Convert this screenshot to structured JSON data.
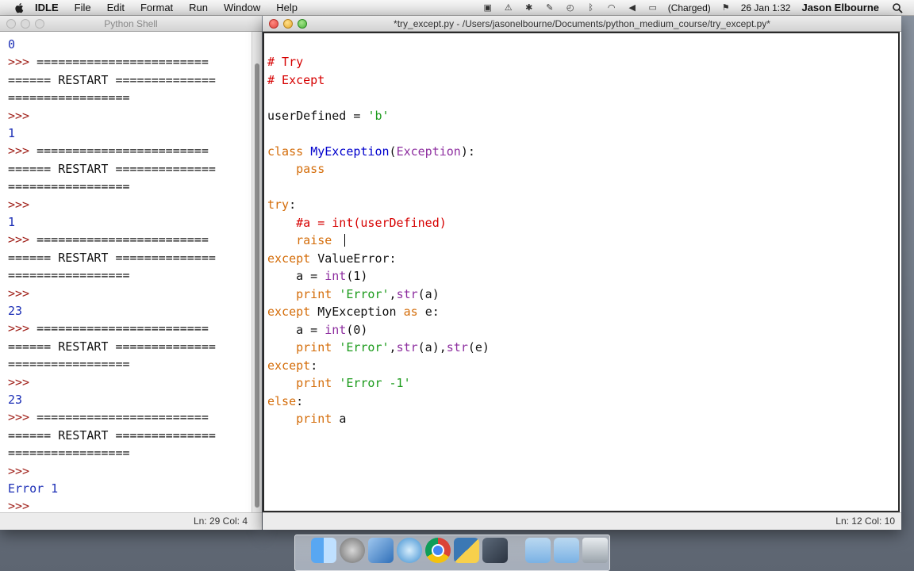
{
  "menubar": {
    "app_name": "IDLE",
    "menus": [
      "File",
      "Edit",
      "Format",
      "Run",
      "Window",
      "Help"
    ],
    "battery_status": "(Charged)",
    "datetime": "26 Jan  1:32",
    "user": "Jason Elbourne"
  },
  "shell": {
    "title": "Python Shell",
    "status": "Ln: 29  Col: 4",
    "lines": [
      {
        "text": "0",
        "kind": "out"
      },
      {
        "text": ">>> ========================",
        "kind": "restart"
      },
      {
        "text": "====== RESTART ==============",
        "kind": "restart"
      },
      {
        "text": "=================",
        "kind": "restart"
      },
      {
        "text": ">>>",
        "kind": "prompt"
      },
      {
        "text": "1",
        "kind": "out"
      },
      {
        "text": ">>> ========================",
        "kind": "restart"
      },
      {
        "text": "====== RESTART ==============",
        "kind": "restart"
      },
      {
        "text": "=================",
        "kind": "restart"
      },
      {
        "text": ">>>",
        "kind": "prompt"
      },
      {
        "text": "1",
        "kind": "out"
      },
      {
        "text": ">>> ========================",
        "kind": "restart"
      },
      {
        "text": "====== RESTART ==============",
        "kind": "restart"
      },
      {
        "text": "=================",
        "kind": "restart"
      },
      {
        "text": ">>>",
        "kind": "prompt"
      },
      {
        "text": "23",
        "kind": "out"
      },
      {
        "text": ">>> ========================",
        "kind": "restart"
      },
      {
        "text": "====== RESTART ==============",
        "kind": "restart"
      },
      {
        "text": "=================",
        "kind": "restart"
      },
      {
        "text": ">>>",
        "kind": "prompt"
      },
      {
        "text": "23",
        "kind": "out"
      },
      {
        "text": ">>> ========================",
        "kind": "restart"
      },
      {
        "text": "====== RESTART ==============",
        "kind": "restart"
      },
      {
        "text": "=================",
        "kind": "restart"
      },
      {
        "text": ">>>",
        "kind": "prompt"
      },
      {
        "text": "Error 1",
        "kind": "out"
      },
      {
        "text": ">>>",
        "kind": "prompt"
      }
    ]
  },
  "editor": {
    "title": "*try_except.py - /Users/jasonelbourne/Documents/python_medium_course/try_except.py*",
    "status": "Ln: 12  Col: 10",
    "code": [
      [
        {
          "t": "# Try",
          "c": "cm"
        }
      ],
      [
        {
          "t": "# Except",
          "c": "cm"
        }
      ],
      [],
      [
        {
          "t": "userDefined = ",
          "c": "p"
        },
        {
          "t": "'b'",
          "c": "s"
        }
      ],
      [],
      [
        {
          "t": "class ",
          "c": "k"
        },
        {
          "t": "MyException",
          "c": "d"
        },
        {
          "t": "(",
          "c": "p"
        },
        {
          "t": "Exception",
          "c": "b"
        },
        {
          "t": "):",
          "c": "p"
        }
      ],
      [
        {
          "t": "    pass",
          "c": "k"
        }
      ],
      [],
      [
        {
          "t": "try",
          "c": "k"
        },
        {
          "t": ":",
          "c": "p"
        }
      ],
      [
        {
          "t": "    #a = int(userDefined)",
          "c": "cm"
        }
      ],
      [
        {
          "t": "    raise ",
          "c": "k"
        }
      ],
      [
        {
          "t": "except ",
          "c": "k"
        },
        {
          "t": "ValueError",
          "c": "p"
        },
        {
          "t": ":",
          "c": "p"
        }
      ],
      [
        {
          "t": "    a = ",
          "c": "p"
        },
        {
          "t": "int",
          "c": "b"
        },
        {
          "t": "(1)",
          "c": "p"
        }
      ],
      [
        {
          "t": "    print ",
          "c": "k"
        },
        {
          "t": "'Error'",
          "c": "s"
        },
        {
          "t": ",",
          "c": "p"
        },
        {
          "t": "str",
          "c": "b"
        },
        {
          "t": "(a)",
          "c": "p"
        }
      ],
      [
        {
          "t": "except ",
          "c": "k"
        },
        {
          "t": "MyException ",
          "c": "p"
        },
        {
          "t": "as ",
          "c": "k"
        },
        {
          "t": "e:",
          "c": "p"
        }
      ],
      [
        {
          "t": "    a = ",
          "c": "p"
        },
        {
          "t": "int",
          "c": "b"
        },
        {
          "t": "(0)",
          "c": "p"
        }
      ],
      [
        {
          "t": "    print ",
          "c": "k"
        },
        {
          "t": "'Error'",
          "c": "s"
        },
        {
          "t": ",",
          "c": "p"
        },
        {
          "t": "str",
          "c": "b"
        },
        {
          "t": "(a),",
          "c": "p"
        },
        {
          "t": "str",
          "c": "b"
        },
        {
          "t": "(e)",
          "c": "p"
        }
      ],
      [
        {
          "t": "except",
          "c": "k"
        },
        {
          "t": ":",
          "c": "p"
        }
      ],
      [
        {
          "t": "    print ",
          "c": "k"
        },
        {
          "t": "'Error -1'",
          "c": "s"
        }
      ],
      [
        {
          "t": "else",
          "c": "k"
        },
        {
          "t": ":",
          "c": "p"
        }
      ],
      [
        {
          "t": "    print ",
          "c": "k"
        },
        {
          "t": "a",
          "c": "p"
        }
      ]
    ]
  },
  "dock": {
    "items": [
      "finder-icon",
      "launchpad-icon",
      "xcode-icon",
      "mail-icon",
      "chrome-icon",
      "python-launcher-icon",
      "video-app-icon",
      "documents-folder-icon",
      "downloads-folder-icon",
      "trash-icon"
    ]
  },
  "colors": {
    "keyword": "#d46d0a",
    "string": "#1a9a1a",
    "comment": "#d60000",
    "definition": "#0000cc",
    "builtin": "#8e2fa0",
    "shell_output": "#1c2fb6",
    "shell_prompt": "#a0211a"
  }
}
